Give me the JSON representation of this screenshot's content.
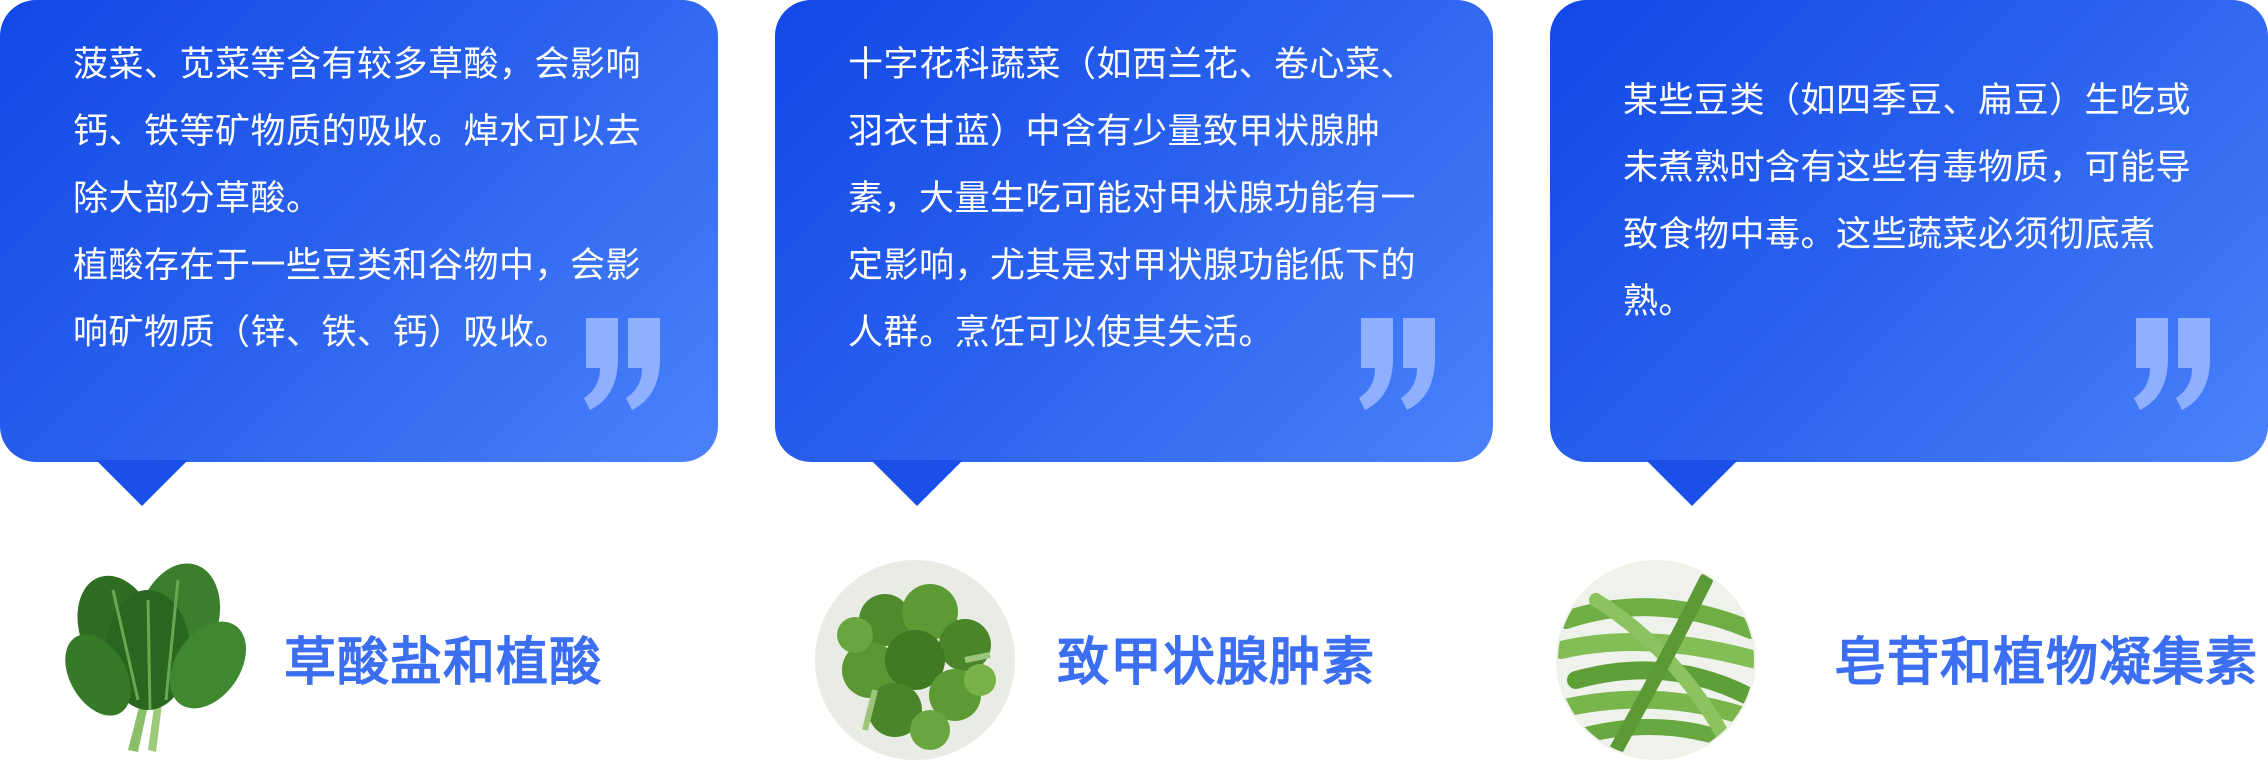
{
  "cards": [
    {
      "paragraphs": [
        "菠菜、苋菜等含有较多草酸，会影响钙、铁等矿物质的吸收。焯水可以去除大部分草酸。",
        "植酸存在于一些豆类和谷物中，会影响矿物质（锌、铁、钙）吸收。"
      ],
      "title": "草酸盐和植酸",
      "image": "spinach"
    },
    {
      "paragraphs": [
        "十字花科蔬菜（如西兰花、卷心菜、羽衣甘蓝）中含有少量致甲状腺肿素，大量生吃可能对甲状腺功能有一定影响，尤其是对甲状腺功能低下的人群。烹饪可以使其失活。"
      ],
      "title": "致甲状腺肿素",
      "image": "broccoli"
    },
    {
      "paragraphs": [
        "某些豆类（如四季豆、扁豆）生吃或未煮熟时含有这些有毒物质，可能导致食物中毒。这些蔬菜必须彻底煮熟。"
      ],
      "title": "皂苷和植物凝集素",
      "image": "green-beans"
    }
  ],
  "colors": {
    "card_start": "#1248e6",
    "card_end": "#4b82fb",
    "title": "#3c6ef2",
    "quote": "#8fb0ff"
  },
  "icons": [
    "quote-icon",
    "spinach-image",
    "broccoli-image",
    "green-beans-image"
  ]
}
